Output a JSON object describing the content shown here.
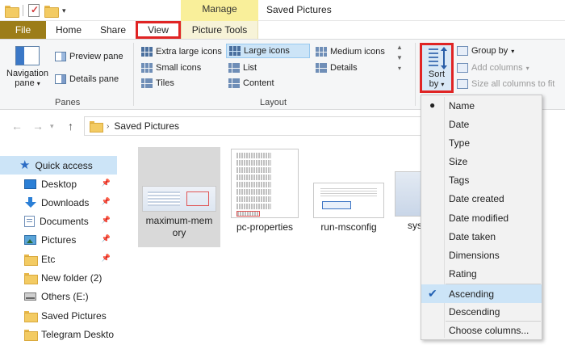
{
  "titlebar": {
    "manage_label": "Manage",
    "window_title": "Saved Pictures"
  },
  "ribbon_tabs": {
    "file": "File",
    "home": "Home",
    "share": "Share",
    "view": "View",
    "picture_tools": "Picture Tools"
  },
  "panes_group": {
    "navigation_pane_line1": "Navigation",
    "navigation_pane_line2": "pane",
    "preview_pane": "Preview pane",
    "details_pane": "Details pane",
    "label": "Panes"
  },
  "layout_group": {
    "extra_large_icons": "Extra large icons",
    "large_icons": "Large icons",
    "medium_icons": "Medium icons",
    "small_icons": "Small icons",
    "list": "List",
    "details": "Details",
    "tiles": "Tiles",
    "content": "Content",
    "label": "Layout",
    "selected": "Large icons"
  },
  "current_view_group": {
    "sort_by_line1": "Sort",
    "sort_by_line2": "by",
    "group_by": "Group by",
    "add_columns": "Add columns",
    "size_all_columns": "Size all columns to fit"
  },
  "address_bar": {
    "path": "Saved Pictures"
  },
  "nav_pane": {
    "items": [
      {
        "label": "Quick access",
        "icon": "star-icon"
      },
      {
        "label": "Desktop",
        "icon": "desktop-icon",
        "pinned": true
      },
      {
        "label": "Downloads",
        "icon": "download-icon",
        "pinned": true
      },
      {
        "label": "Documents",
        "icon": "documents-icon",
        "pinned": true
      },
      {
        "label": "Pictures",
        "icon": "pictures-icon",
        "pinned": true
      },
      {
        "label": "Etc",
        "icon": "folder-icon",
        "pinned": true
      },
      {
        "label": "New folder (2)",
        "icon": "folder-icon"
      },
      {
        "label": "Others (E:)",
        "icon": "drive-icon"
      },
      {
        "label": "Saved Pictures",
        "icon": "folder-icon"
      },
      {
        "label": "Telegram Deskto",
        "icon": "folder-icon"
      }
    ]
  },
  "files": {
    "items": [
      {
        "line1": "maximum-mem",
        "line2": "ory",
        "selected": true
      },
      {
        "line1": "pc-properties",
        "line2": ""
      },
      {
        "line1": "run-msconfig",
        "line2": ""
      },
      {
        "line1": "sys",
        "line2": ""
      }
    ]
  },
  "sort_menu": {
    "items": [
      "Name",
      "Date",
      "Type",
      "Size",
      "Tags",
      "Date created",
      "Date modified",
      "Date taken",
      "Dimensions",
      "Rating"
    ],
    "selected_field": "Name",
    "ascending": "Ascending",
    "descending": "Descending",
    "order_selected": "Ascending",
    "choose_columns": "Choose columns..."
  },
  "colors": {
    "file_tab": "#9c7d19",
    "manage_tab": "#f9ef9a",
    "highlight_box": "#e02424",
    "selection": "#cce4f7",
    "check": "#2160b3"
  }
}
